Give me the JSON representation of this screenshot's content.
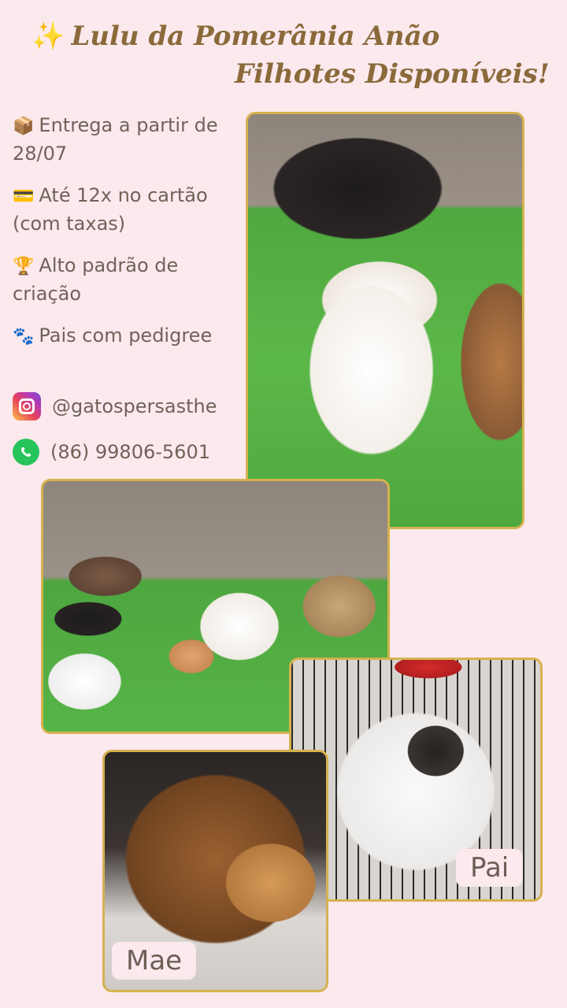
{
  "header": {
    "sparkle_icon": "sparkles-icon",
    "title_line1": "Lulu da Pomerânia Anão",
    "title_line2": "Filhotes Disponíveis!"
  },
  "info": [
    {
      "icon": "package-icon",
      "emoji": "📦",
      "text": "Entrega a partir de 28/07"
    },
    {
      "icon": "credit-card-icon",
      "emoji": "💳",
      "text": "Até 12x no cartão (com taxas)"
    },
    {
      "icon": "trophy-icon",
      "emoji": "🏆",
      "text": "Alto padrão de criação"
    },
    {
      "icon": "paw-prints-icon",
      "emoji": "🐾",
      "text": "Pais com pedigree"
    }
  ],
  "social": {
    "instagram": "@gatospersasthe",
    "whatsapp": "(86) 99806-5601"
  },
  "photos": {
    "pai_label": "Pai",
    "mae_label": "Mae"
  },
  "colors": {
    "background": "#fbe9ee",
    "title": "#8a6a3a",
    "frame": "#d6b24f"
  }
}
